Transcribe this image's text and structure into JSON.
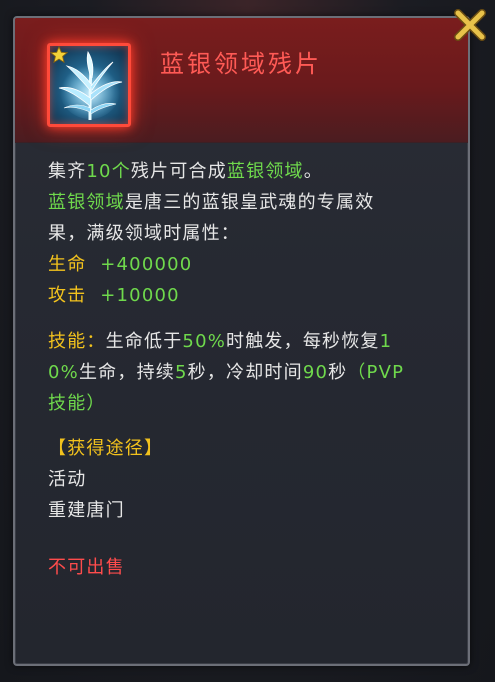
{
  "item": {
    "name": "蓝银领域残片",
    "icon": "blue-silver-grass-icon"
  },
  "description": {
    "collect_prefix": "集齐",
    "collect_count": "10个",
    "collect_mid": "残片可合成",
    "collect_target": "蓝银领域",
    "collect_end": "。",
    "domain_name": "蓝银领域",
    "domain_desc_1": "是唐三的蓝银皇武魂的专属效",
    "domain_desc_2": "果，满级领域时属性："
  },
  "stats": [
    {
      "label": "生命",
      "value": "+400000"
    },
    {
      "label": "攻击",
      "value": "+10000"
    }
  ],
  "skill": {
    "label": "技能：",
    "p1": "生命低于",
    "v1": "50%",
    "p2": "时触发，每秒恢复",
    "v2a": "1",
    "v2b": "0%",
    "p3": "生命，持续",
    "v3": "5",
    "p4": "秒，冷却时间",
    "v4": "90",
    "p5": "秒",
    "pvp_a": "（PVP",
    "pvp_b": "技能）"
  },
  "obtain": {
    "header": "【获得途径】",
    "sources": [
      "活动",
      "重建唐门"
    ]
  },
  "sell_status": "不可出售",
  "colors": {
    "title": "#ff5a55",
    "highlight_green": "#6fd94c",
    "stat_yellow": "#f2c21d",
    "warning_red": "#ff4c4c",
    "close_gold": "#e8c24a"
  }
}
